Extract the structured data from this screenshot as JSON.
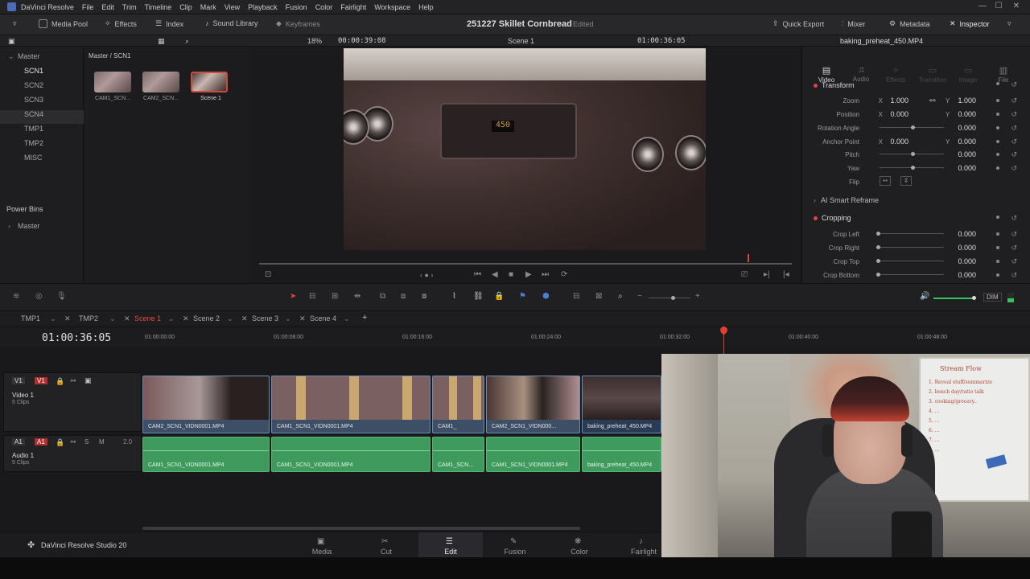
{
  "app": {
    "name": "DaVinci Resolve",
    "menus": [
      "File",
      "Edit",
      "Trim",
      "Timeline",
      "Clip",
      "Mark",
      "View",
      "Playback",
      "Fusion",
      "Color",
      "Fairlight",
      "Workspace",
      "Help"
    ]
  },
  "toolbar": {
    "media_pool": "Media Pool",
    "effects": "Effects",
    "index": "Index",
    "sound_library": "Sound Library",
    "keyframes": "Keyframes",
    "project_title": "251227 Skillet Cornbread",
    "project_status": "Edited",
    "quick_export": "Quick Export",
    "mixer": "Mixer",
    "metadata": "Metadata",
    "inspector": "Inspector"
  },
  "subbar": {
    "zoom": "18%",
    "source_tc": "00:00:39:08",
    "timeline_name": "Scene 1",
    "record_tc": "01:00:36:05",
    "clip_name": "baking_preheat_450.MP4"
  },
  "bins": {
    "master": "Master",
    "items": [
      "SCN1",
      "SCN2",
      "SCN3",
      "SCN4",
      "TMP1",
      "TMP2",
      "MISC"
    ],
    "power_bins": "Power Bins",
    "power_master": "Master"
  },
  "mediapool": {
    "path": "Master / SCN1",
    "clips": [
      "CAM1_SCN...",
      "CAM2_SCN...",
      "Scene 1"
    ]
  },
  "viewer": {
    "display": "450"
  },
  "inspector": {
    "tabs": [
      "Video",
      "Audio",
      "Effects",
      "Transition",
      "Image",
      "File"
    ],
    "transform": "Transform",
    "zoom_label": "Zoom",
    "zoom_x": "1.000",
    "zoom_y": "1.000",
    "position_label": "Position",
    "position_x": "0.000",
    "position_y": "0.000",
    "rotation_label": "Rotation Angle",
    "rotation": "0.000",
    "anchor_label": "Anchor Point",
    "anchor_x": "0.000",
    "anchor_y": "0.000",
    "pitch_label": "Pitch",
    "pitch": "0.000",
    "yaw_label": "Yaw",
    "yaw": "0.000",
    "flip_label": "Flip",
    "smart_reframe": "AI Smart Reframe",
    "cropping": "Cropping",
    "crop_left_label": "Crop Left",
    "crop_left": "0.000",
    "crop_right_label": "Crop Right",
    "crop_right": "0.000",
    "crop_top_label": "Crop Top",
    "crop_top": "0.000",
    "crop_bottom_label": "Crop Bottom",
    "crop_bottom": "0.000",
    "x": "X",
    "y": "Y"
  },
  "timeline": {
    "tabs": [
      "TMP1",
      "TMP2",
      "Scene 1",
      "Scene 2",
      "Scene 3",
      "Scene 4"
    ],
    "timecode": "01:00:36:05",
    "ruler": [
      "01:00:00:00",
      "01:00:08:00",
      "01:00:16:00",
      "01:00:24:00",
      "01:00:32:00",
      "01:00:40:00",
      "01:00:48:00"
    ],
    "dim": "DIM",
    "video_track": {
      "badge": "V1",
      "name": "Video 1",
      "count": "5 Clips"
    },
    "audio_track": {
      "badge": "A1",
      "name": "Audio 1",
      "count": "5 Clips",
      "level": "2.0"
    },
    "video_clips": [
      "CAM2_SCN1_VIDN0001.MP4",
      "CAM1_SCN1_VIDN0001.MP4",
      "CAM1_",
      "CAM2_SCN1_VIDN000...",
      "baking_preheat_450.MP4"
    ],
    "audio_clips": [
      "CAM1_SCN1_VIDN0001.MP4",
      "CAM1_SCN1_VIDN0001.MP4",
      "CAM1_SCN...",
      "CAM1_SCN1_VIDN0001.MP4",
      "baking_preheat_450.MP4"
    ]
  },
  "pages": {
    "brand": "DaVinci Resolve Studio 20",
    "items": [
      "Media",
      "Cut",
      "Edit",
      "Fusion",
      "Color",
      "Fairlight"
    ]
  },
  "webcam": {
    "board_title": "Stream Flow",
    "board_lines": [
      "1. Reveal stuff/summarize",
      "2. bench day/ratio talk",
      "3. cooking/grocery..",
      "4. ...",
      "5. ...",
      "6. ...",
      "7. ...",
      "8. ..."
    ]
  }
}
